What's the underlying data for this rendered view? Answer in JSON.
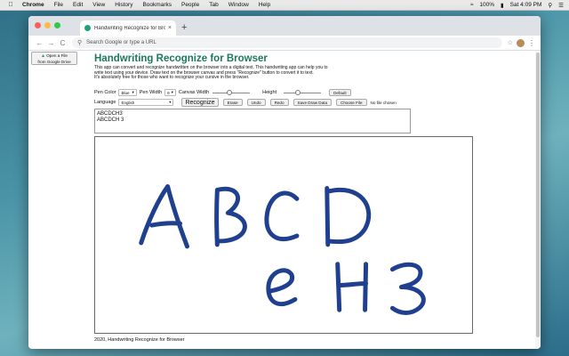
{
  "menubar": {
    "apple": "",
    "app": "Chrome",
    "items": [
      "File",
      "Edit",
      "View",
      "History",
      "Bookmarks",
      "People",
      "Tab",
      "Window",
      "Help"
    ],
    "battery": "100%",
    "clock": "Sat 4:09 PM"
  },
  "browser": {
    "tab_title": "Handwriting Recognize for Bro",
    "tab_close": "×",
    "new_tab": "+",
    "omnibox_placeholder": "Search Google or type a URL",
    "nav_back": "←",
    "nav_forward": "→",
    "nav_reload": "C",
    "menu_dots": "⋮"
  },
  "page": {
    "drive_button": {
      "line1": "Open a File",
      "line2": "from Google Drive"
    },
    "title": "Handwriting Recognize for Browser",
    "description": [
      "This app can convert and recognize handwritten on the browser into a digital text. This handwriting app can help you to",
      "write text using your device. Draw text on the browser canvas and press \"Recognize\" button to convert it to text.",
      "It's absolutely free for those who want to recognize your cursive in the browser."
    ],
    "controls": {
      "pen_color_label": "Pen Color",
      "pen_color_value": "Blue",
      "pen_width_label": "Pen Width",
      "pen_width_value": "9",
      "canvas_width_label": "Canvas Width",
      "canvas_width_level": 0.45,
      "height_label": "Height",
      "height_level": 0.35,
      "default_button": "Default",
      "language_label": "Language",
      "language_value": "English",
      "recognize_button": "Recognize",
      "erase_button": "Erase",
      "undo_button": "Undo",
      "redo_button": "Redo",
      "save_button": "Save Draw Data",
      "choose_file_button": "Choose File",
      "no_file": "No file chosen"
    },
    "result_lines": [
      "ABCDCH3",
      "ABCDCH 3"
    ],
    "ink_color": "#1f3f8f",
    "footer": "2020, Handwriting Recognize for Browser"
  }
}
